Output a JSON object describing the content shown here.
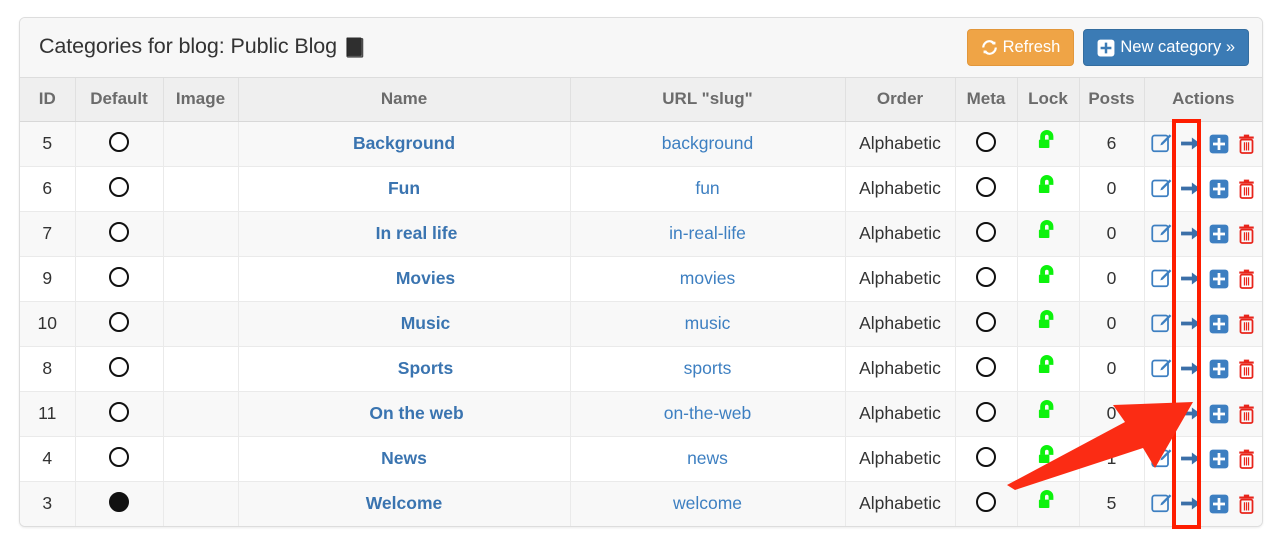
{
  "panel": {
    "title": "Categories for blog: Public Blog",
    "title_icon": "book-icon",
    "buttons": {
      "refresh_label": "Refresh",
      "refresh_icon": "refresh-icon",
      "refresh_color": "#efa446",
      "new_category_label": "New category »",
      "new_category_icon": "plus-square-icon",
      "new_category_color": "#3b7bb5"
    }
  },
  "table": {
    "columns": [
      {
        "key": "id",
        "label": "ID"
      },
      {
        "key": "default",
        "label": "Default"
      },
      {
        "key": "image",
        "label": "Image"
      },
      {
        "key": "name",
        "label": "Name"
      },
      {
        "key": "slug",
        "label": "URL \"slug\""
      },
      {
        "key": "order",
        "label": "Order"
      },
      {
        "key": "meta",
        "label": "Meta"
      },
      {
        "key": "lock",
        "label": "Lock"
      },
      {
        "key": "posts",
        "label": "Posts"
      },
      {
        "key": "actions",
        "label": "Actions"
      }
    ],
    "rows": [
      {
        "id": "5",
        "default": false,
        "image": "",
        "name": "Background",
        "indent": 0,
        "slug": "background",
        "order": "Alphabetic",
        "meta": false,
        "lock": "unlocked",
        "posts": "6"
      },
      {
        "id": "6",
        "default": false,
        "image": "",
        "name": "Fun",
        "indent": 0,
        "slug": "fun",
        "order": "Alphabetic",
        "meta": false,
        "lock": "unlocked",
        "posts": "0"
      },
      {
        "id": "7",
        "default": false,
        "image": "",
        "name": "In real life",
        "indent": 1,
        "slug": "in-real-life",
        "order": "Alphabetic",
        "meta": false,
        "lock": "unlocked",
        "posts": "0"
      },
      {
        "id": "9",
        "default": false,
        "image": "",
        "name": "Movies",
        "indent": 2,
        "slug": "movies",
        "order": "Alphabetic",
        "meta": false,
        "lock": "unlocked",
        "posts": "0"
      },
      {
        "id": "10",
        "default": false,
        "image": "",
        "name": "Music",
        "indent": 2,
        "slug": "music",
        "order": "Alphabetic",
        "meta": false,
        "lock": "unlocked",
        "posts": "0"
      },
      {
        "id": "8",
        "default": false,
        "image": "",
        "name": "Sports",
        "indent": 2,
        "slug": "sports",
        "order": "Alphabetic",
        "meta": false,
        "lock": "unlocked",
        "posts": "0"
      },
      {
        "id": "11",
        "default": false,
        "image": "",
        "name": "On the web",
        "indent": 1,
        "slug": "on-the-web",
        "order": "Alphabetic",
        "meta": false,
        "lock": "unlocked",
        "posts": "0"
      },
      {
        "id": "4",
        "default": false,
        "image": "",
        "name": "News",
        "indent": 0,
        "slug": "news",
        "order": "Alphabetic",
        "meta": false,
        "lock": "unlocked",
        "posts": "1"
      },
      {
        "id": "3",
        "default": true,
        "image": "",
        "name": "Welcome",
        "indent": 0,
        "slug": "welcome",
        "order": "Alphabetic",
        "meta": false,
        "lock": "unlocked",
        "posts": "5"
      }
    ],
    "row_actions": [
      {
        "name": "edit-icon",
        "color": "#3d7fc1"
      },
      {
        "name": "arrow-right-icon",
        "color": "#3b6fa8"
      },
      {
        "name": "add-icon",
        "color": "#3d7fc1"
      },
      {
        "name": "delete-icon",
        "color": "#e8241b"
      }
    ]
  },
  "annotation": {
    "highlight_color": "#fe1d00",
    "highlight_target": "arrow-right-action-column",
    "arrow_color": "#fb2c14"
  }
}
